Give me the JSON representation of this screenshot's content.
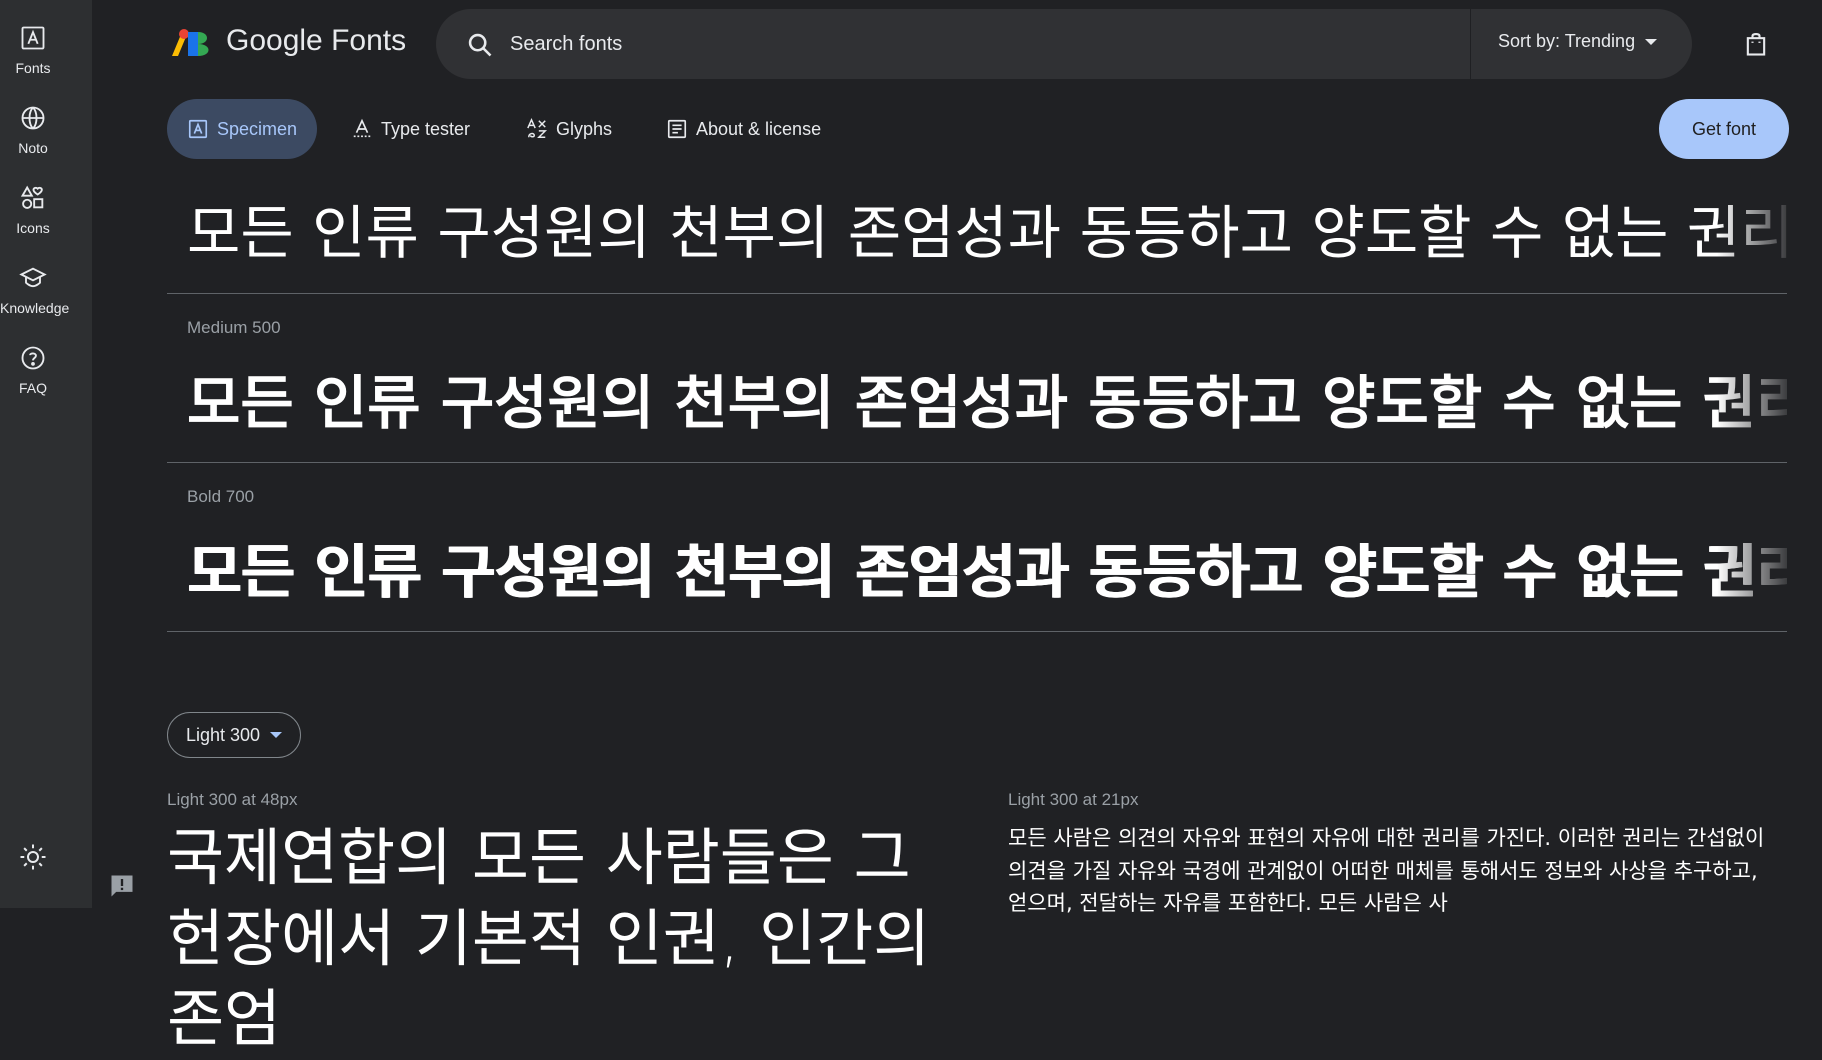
{
  "nav": {
    "items": [
      {
        "label": "Fonts",
        "icon": "font-a-icon"
      },
      {
        "label": "Noto",
        "icon": "globe-icon"
      },
      {
        "label": "Icons",
        "icon": "shapes-icon"
      },
      {
        "label": "Knowledge",
        "icon": "graduation-cap-icon"
      },
      {
        "label": "FAQ",
        "icon": "help-circle-icon"
      }
    ]
  },
  "header": {
    "brand": "Google Fonts",
    "search_placeholder": "Search fonts",
    "sort_label": "Sort by: Trending"
  },
  "tabs": {
    "specimen": "Specimen",
    "type_tester": "Type tester",
    "glyphs": "Glyphs",
    "about": "About & license",
    "get_font": "Get font"
  },
  "styles": {
    "sample_text": "모든 인류 구성원의 천부의 존엄성과 동등하고 양도할 수 없는 권리를",
    "rows": [
      {
        "label": ""
      },
      {
        "label": "Medium 500"
      },
      {
        "label": "Bold 700"
      }
    ]
  },
  "paragraph": {
    "weight_select": "Light 300",
    "large_label": "Light 300 at 48px",
    "large_text": "국제연합의 모든 사람들은 그 헌장에서 기본적 인권, 인간의 존엄",
    "small_label": "Light 300 at 21px",
    "small_text": "모든 사람은 의견의 자유와 표현의 자유에 대한 권리를 가진다. 이러한 권리는 간섭없이 의견을 가질 자유와 국경에 관계없이 어떠한 매체를 통해서도 정보와 사상을 추구하고, 얻으며, 전달하는 자유를 포함한다. 모든 사람은 사"
  },
  "colors": {
    "background": "#202124",
    "rail": "#2d2f31",
    "accent": "#a8c7fa",
    "active_tab": "#3c4a62"
  }
}
